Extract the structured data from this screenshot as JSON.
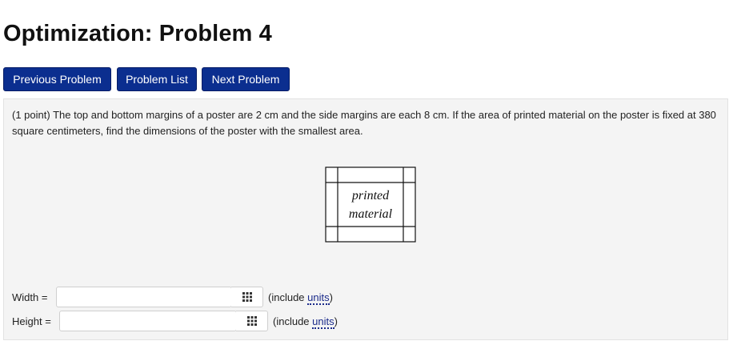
{
  "page_title": "Optimization: Problem 4",
  "nav": {
    "previous": "Previous Problem",
    "list": "Problem List",
    "next": "Next Problem"
  },
  "problem": {
    "text": "(1 point) The top and bottom margins of a poster are 2 cm and the side margins are each 8 cm. If the area of printed material on the poster is fixed at 380 square centimeters, find the dimensions of the poster with the smallest area.",
    "diagram": {
      "label_line1": "printed",
      "label_line2": "material"
    }
  },
  "answers": {
    "width_label": "Width =",
    "height_label": "Height =",
    "width_value": "",
    "height_value": "",
    "include_open": "(include ",
    "units_link": "units",
    "include_close": ")"
  },
  "icons": {
    "grid": "grid-icon"
  }
}
